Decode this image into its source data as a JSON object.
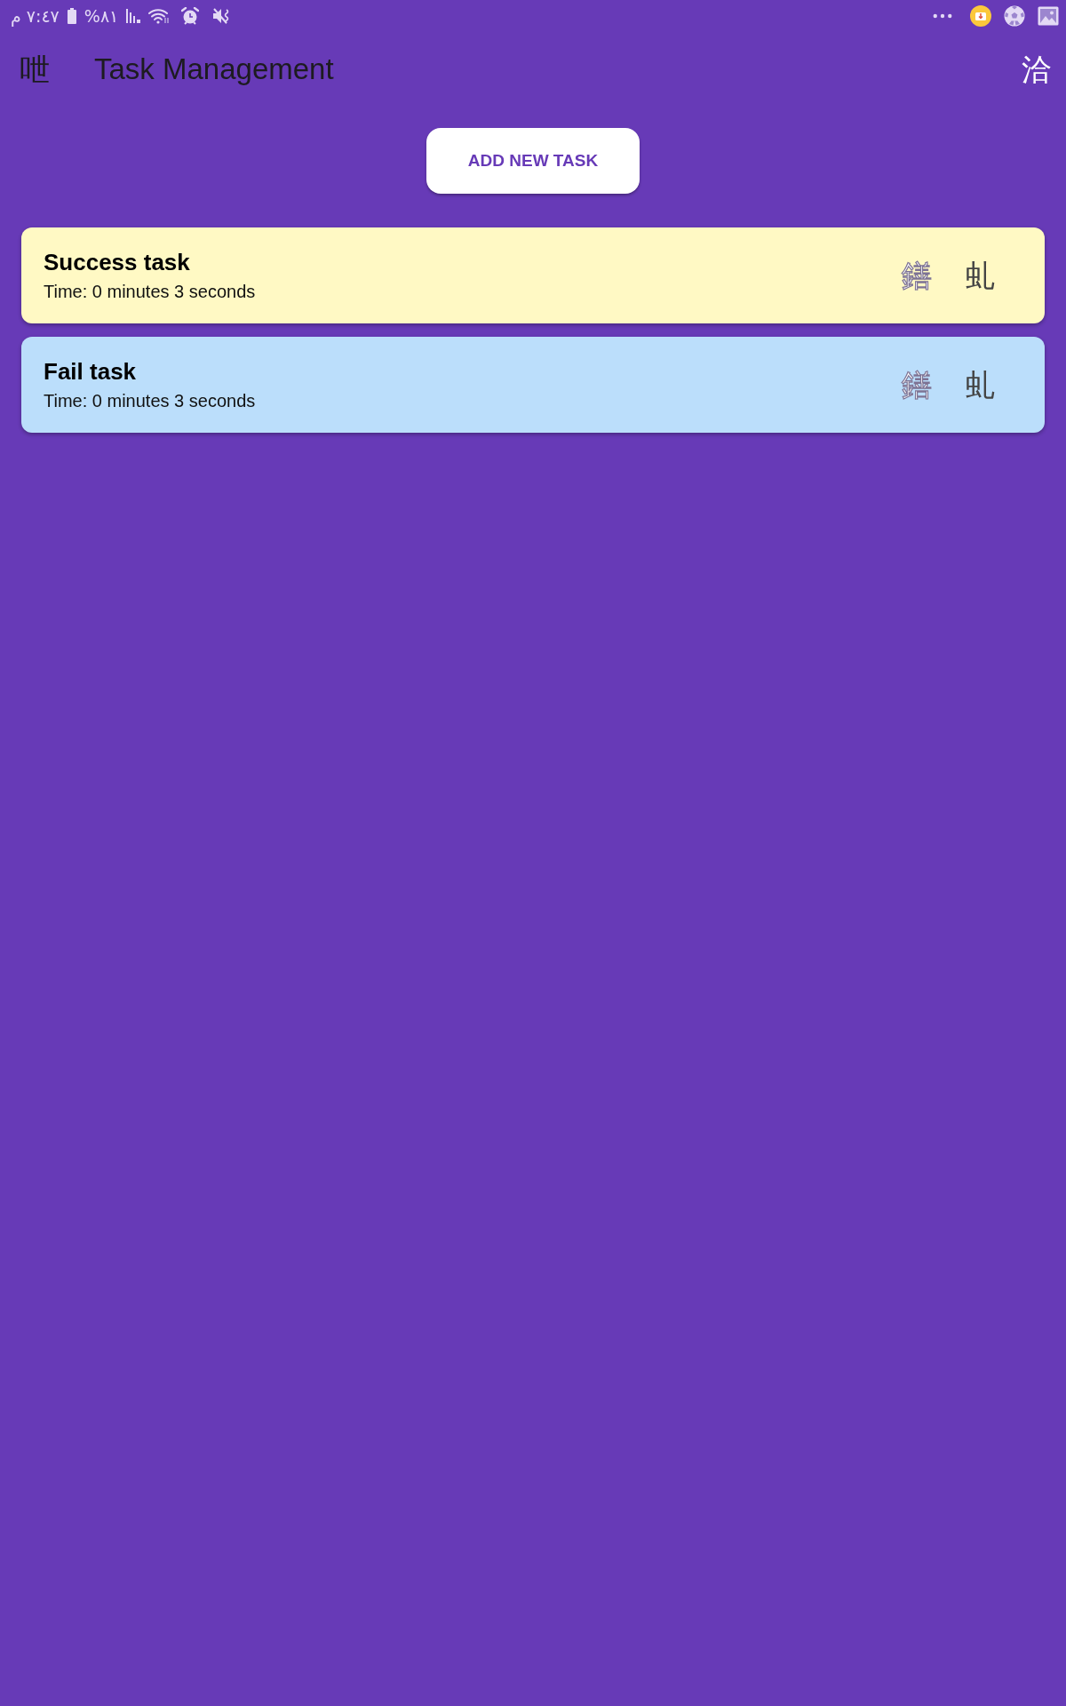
{
  "status_bar": {
    "time": "٧:٤٧ م",
    "battery": "٨١%"
  },
  "app_bar": {
    "leading_glyph": "呭",
    "title": "Task Management",
    "action_glyph": "洽"
  },
  "add_button": {
    "label": "ADD NEW TASK"
  },
  "tasks": [
    {
      "title": "Success task",
      "time": "Time: 0 minutes 3 seconds",
      "color": "#fff9c4",
      "action_glyphs": [
        "鐥",
        "虬"
      ]
    },
    {
      "title": "Fail task",
      "time": "Time: 0 minutes 3 seconds",
      "color": "#bbdefb",
      "action_glyphs": [
        "鐥",
        "虬"
      ]
    }
  ]
}
